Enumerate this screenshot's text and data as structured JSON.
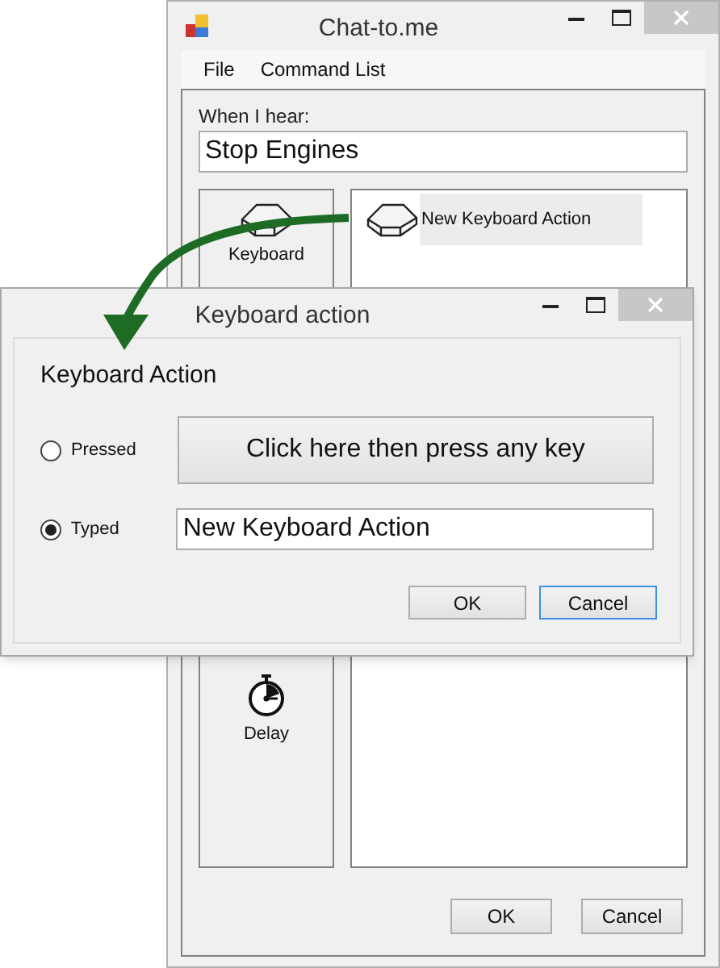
{
  "main_window": {
    "title": "Chat-to.me",
    "menu": [
      "File",
      "Command List"
    ],
    "trigger": {
      "label": "When I hear:",
      "value": "Stop Engines"
    },
    "palette": [
      {
        "label": "Keyboard",
        "kind": "keyboard"
      },
      {
        "label": "Delay",
        "kind": "delay"
      }
    ],
    "actions": [
      {
        "label": "New Keyboard Action",
        "kind": "keyboard",
        "selected": true
      }
    ],
    "buttons": [
      {
        "label": "OK",
        "focused": false
      },
      {
        "label": "Cancel",
        "focused": false
      }
    ]
  },
  "dialog": {
    "title": "Keyboard action",
    "heading": "Keyboard Action",
    "options": [
      {
        "label": "Pressed",
        "selected": false,
        "kind": "capture",
        "button_label": "Click here then press any key"
      },
      {
        "label": "Typed",
        "selected": true,
        "kind": "text",
        "value": "New Keyboard Action"
      }
    ],
    "buttons": [
      {
        "label": "OK",
        "focused": false
      },
      {
        "label": "Cancel",
        "focused": true
      }
    ]
  }
}
